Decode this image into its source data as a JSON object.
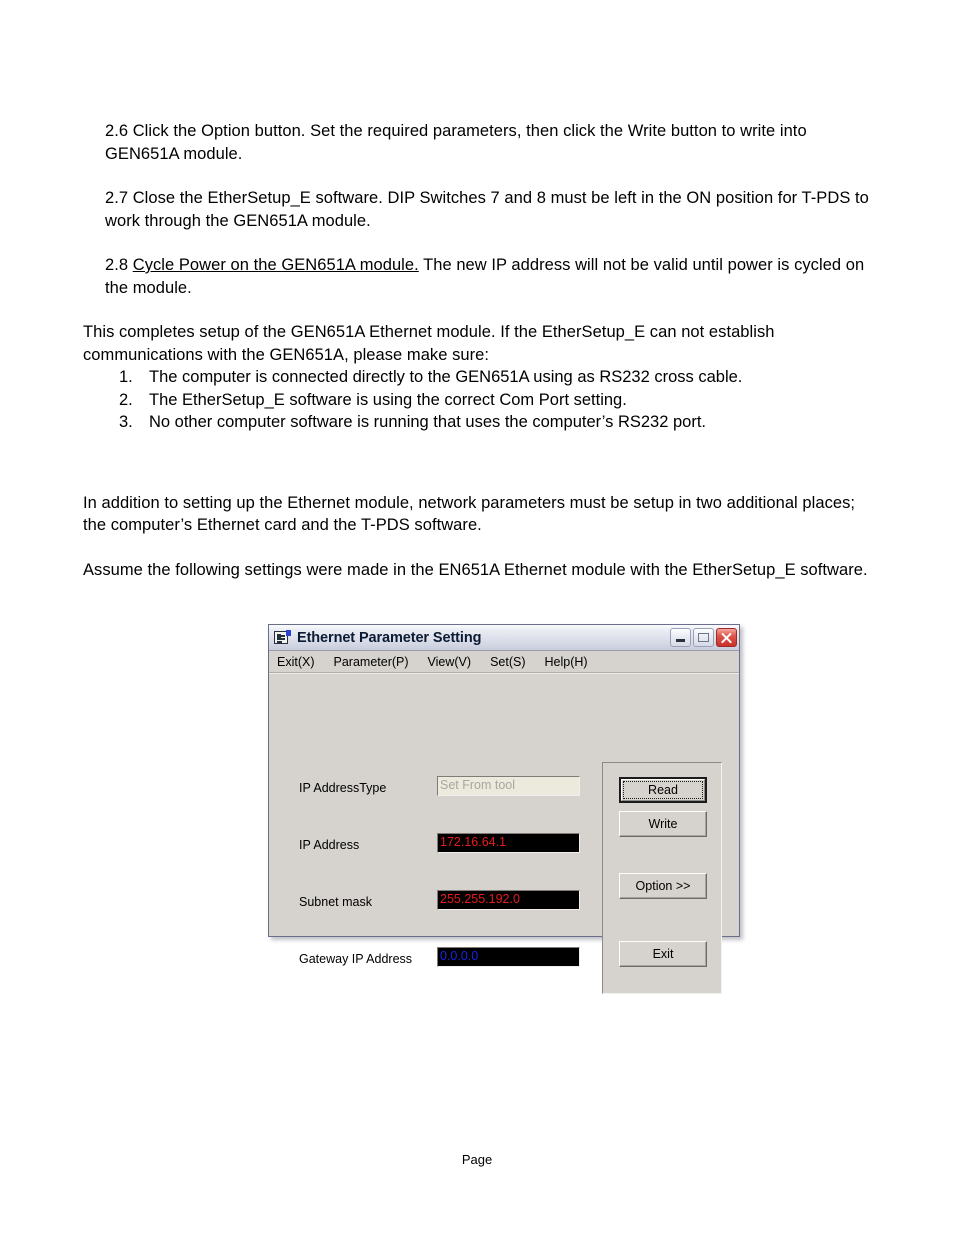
{
  "document": {
    "sections": [
      {
        "id": "s26",
        "text": "2.6  Click the Option button.  Set the required parameters, then click the Write button to write into GEN651A module."
      },
      {
        "id": "s27",
        "text": "2.7  Close the EtherSetup_E software.  DIP Switches 7 and 8 must be left in the ON position for T-PDS to work through the GEN651A module."
      },
      {
        "id": "s28",
        "prefix": "2.8  ",
        "underlined": "Cycle Power on the GEN651A module.",
        "rest": "  The new IP address will not be valid until power is cycled on the module."
      }
    ],
    "completes_paragraph": "This completes setup of the GEN651A Ethernet module.  If the EtherSetup_E can not establish communications with the GEN651A, please make sure:",
    "checklist": [
      {
        "num": "1.",
        "text": "The computer is connected directly to the GEN651A using as RS232 cross cable."
      },
      {
        "num": "2.",
        "text": "The EtherSetup_E software is using the correct Com Port setting."
      },
      {
        "num": "3.",
        "text": "No other computer software is running that uses the computer’s RS232 port."
      }
    ],
    "addition_paragraph": "  In addition to setting up the Ethernet module, network parameters must be setup in two additional places; the computer’s Ethernet card and the T-PDS software.",
    "assume_paragraph": "Assume the following settings were made in the EN651A Ethernet module with the EtherSetup_E software.",
    "footer": "Page"
  },
  "dialog": {
    "title": "Ethernet Parameter Setting",
    "title_icon": "document-form-icon",
    "window_controls": {
      "minimize": "minimize-icon",
      "maximize": "maximize-icon",
      "close": "close-icon"
    },
    "menu": [
      {
        "label": "Exit(X)"
      },
      {
        "label": "Parameter(P)"
      },
      {
        "label": "View(V)"
      },
      {
        "label": "Set(S)"
      },
      {
        "label": "Help(H)"
      }
    ],
    "fields": [
      {
        "label": "IP AddressType",
        "value": "Set From tool",
        "state": "disabled",
        "text_color": "#a9a69c",
        "bg_color": "#ece9dd"
      },
      {
        "label": "IP Address",
        "value": "172.16.64.1",
        "state": "enabled",
        "text_color": "#e81b1b",
        "bg_color": "#000000"
      },
      {
        "label": "Subnet mask",
        "value": "255.255.192.0",
        "state": "enabled",
        "text_color": "#e81b1b",
        "bg_color": "#000000"
      },
      {
        "label": "Gateway IP Address",
        "value": "0.0.0.0",
        "state": "enabled",
        "text_color": "#1b22e8",
        "bg_color": "#000000"
      }
    ],
    "buttons": [
      {
        "label": "Read",
        "default": true
      },
      {
        "label": "Write",
        "default": false
      },
      {
        "label": "Option >>",
        "default": false
      },
      {
        "label": "Exit",
        "default": false
      }
    ]
  }
}
